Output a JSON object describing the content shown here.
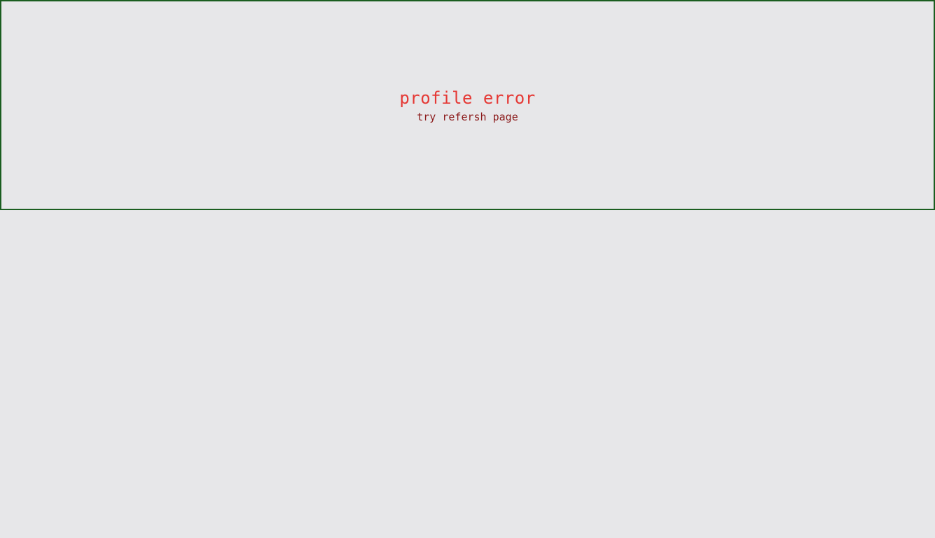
{
  "error": {
    "title": "profile error",
    "hint": "try refersh page"
  },
  "colors": {
    "background": "#e7e7e9",
    "panel_border": "#1b5e20",
    "title_text": "#e53935",
    "hint_text": "#8b1a1a"
  }
}
